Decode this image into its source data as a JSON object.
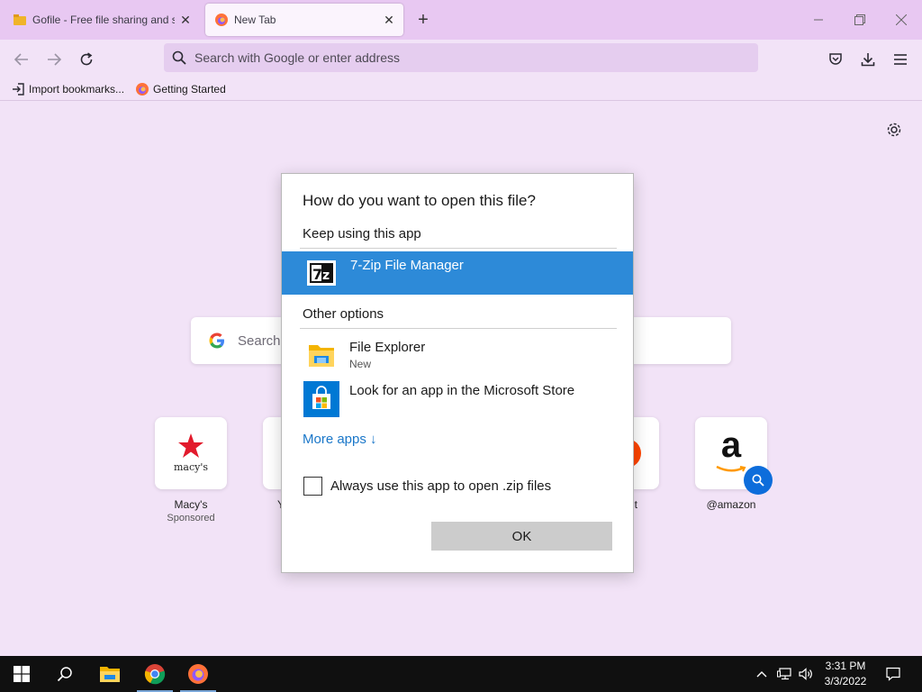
{
  "tabs": [
    {
      "title": "Gofile - Free file sharing and sto",
      "active": false
    },
    {
      "title": "New Tab",
      "active": true
    }
  ],
  "nav": {
    "url_placeholder": "Search with Google or enter address"
  },
  "bookmarks": [
    {
      "label": "Import bookmarks..."
    },
    {
      "label": "Getting Started"
    }
  ],
  "newtab": {
    "search_placeholder": "Search",
    "tiles": [
      {
        "label": "Macy's",
        "sub": "Sponsored",
        "logo_text": "macy's"
      },
      {
        "label": "Y",
        "sub": ""
      },
      {
        "label": "t",
        "sub": ""
      },
      {
        "label": "@amazon",
        "sub": "",
        "logo_text": "a"
      }
    ]
  },
  "dialog": {
    "title": "How do you want to open this file?",
    "keep_label": "Keep using this app",
    "current_app": "7-Zip File Manager",
    "current_app_icon_text": "7z",
    "other_label": "Other options",
    "apps": [
      {
        "name": "File Explorer",
        "sub": "New"
      },
      {
        "name": "Look for an app in the Microsoft Store",
        "sub": ""
      }
    ],
    "more_apps": "More apps ↓",
    "always_label": "Always use this app to open .zip files",
    "always_checked": false,
    "ok": "OK"
  },
  "taskbar": {
    "time": "3:31 PM",
    "date": "3/3/2022"
  },
  "colors": {
    "accent": "#2d8ad8",
    "tabstrip": "#e8c8f2",
    "page_bg": "#f2e3f7"
  }
}
